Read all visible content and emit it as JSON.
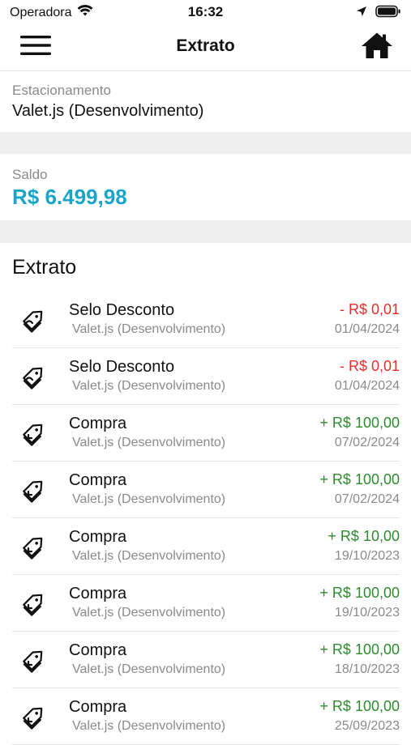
{
  "status_bar": {
    "carrier": "Operadora",
    "time": "16:32",
    "icons": [
      "wifi-icon",
      "location-arrow-icon",
      "battery-icon"
    ]
  },
  "nav": {
    "title": "Extrato",
    "menu_icon": "hamburger-menu-icon",
    "home_icon": "home-icon"
  },
  "parking": {
    "label": "Estacionamento",
    "value": "Valet.js (Desenvolvimento)"
  },
  "balance": {
    "label": "Saldo",
    "value": "R$ 6.499,98",
    "color": "#1aa5c8"
  },
  "statement": {
    "heading": "Extrato",
    "colors": {
      "negative": "#e0312e",
      "positive": "#2e8b2e"
    },
    "transactions": [
      {
        "title": "Selo Desconto",
        "subtitle": "Valet.js (Desenvolvimento)",
        "amount": "- R$ 0,01",
        "date": "01/04/2024",
        "kind": "neg",
        "icon": "discount-tag-icon"
      },
      {
        "title": "Selo Desconto",
        "subtitle": "Valet.js (Desenvolvimento)",
        "amount": "- R$ 0,01",
        "date": "01/04/2024",
        "kind": "neg",
        "icon": "discount-tag-icon"
      },
      {
        "title": "Compra",
        "subtitle": "Valet.js (Desenvolvimento)",
        "amount": "+ R$ 100,00",
        "date": "07/02/2024",
        "kind": "pos",
        "icon": "purchase-tag-icon"
      },
      {
        "title": "Compra",
        "subtitle": "Valet.js (Desenvolvimento)",
        "amount": "+ R$ 100,00",
        "date": "07/02/2024",
        "kind": "pos",
        "icon": "purchase-tag-icon"
      },
      {
        "title": "Compra",
        "subtitle": "Valet.js (Desenvolvimento)",
        "amount": "+ R$ 10,00",
        "date": "19/10/2023",
        "kind": "pos",
        "icon": "purchase-tag-icon"
      },
      {
        "title": "Compra",
        "subtitle": "Valet.js (Desenvolvimento)",
        "amount": "+ R$ 100,00",
        "date": "19/10/2023",
        "kind": "pos",
        "icon": "purchase-tag-icon"
      },
      {
        "title": "Compra",
        "subtitle": "Valet.js (Desenvolvimento)",
        "amount": "+ R$ 100,00",
        "date": "18/10/2023",
        "kind": "pos",
        "icon": "purchase-tag-icon"
      },
      {
        "title": "Compra",
        "subtitle": "Valet.js (Desenvolvimento)",
        "amount": "+ R$ 100,00",
        "date": "25/09/2023",
        "kind": "pos",
        "icon": "purchase-tag-icon"
      }
    ]
  }
}
